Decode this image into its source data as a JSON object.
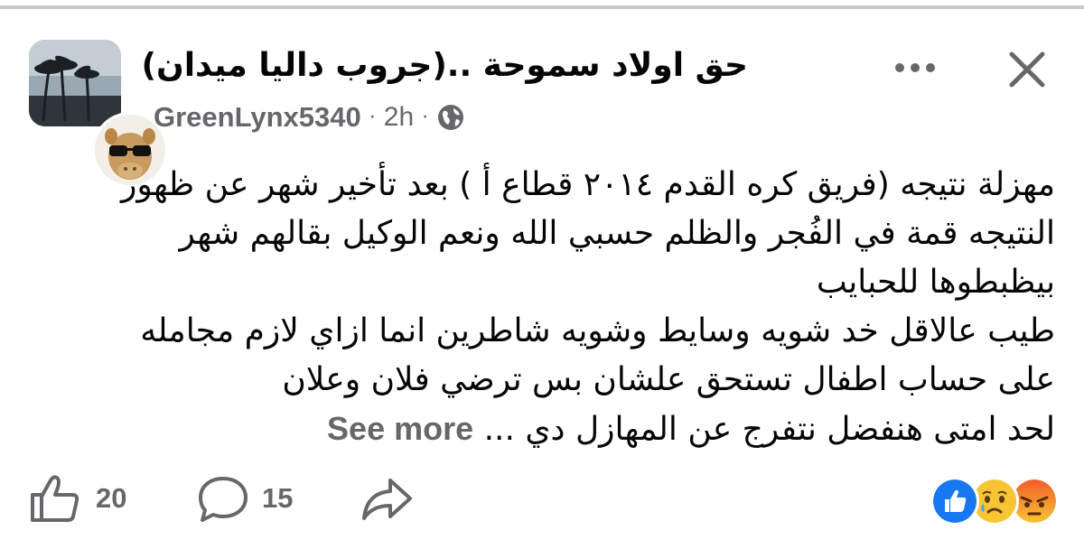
{
  "header": {
    "group_title": "حق اولاد سموحة ..(جروب داليا ميدان)",
    "author": "GreenLynx5340",
    "separator": "·",
    "time": "2h",
    "privacy_icon": "globe-icon",
    "more_icon": "more-dots-icon",
    "close_icon": "close-icon"
  },
  "post": {
    "lines": [
      "مهزلة نتيجه (فريق كره القدم ٢٠١٤ قطاع أ ) بعد تأخير شهر عن ظهور",
      "النتيجه قمة في الفُجر والظلم حسبي الله ونعم الوكيل بقالهم شهر",
      "بيظبطوها للحبايب",
      "طيب عالاقل خد شويه وسايط وشويه شاطرين انما ازاي لازم مجامله",
      "على حساب اطفال تستحق علشان بس ترضي فلان وعلان",
      "لحد امتى هنفضل نتفرج عن المهازل دي ..."
    ],
    "see_more": "See more"
  },
  "footer": {
    "like_count": "20",
    "comment_count": "15",
    "reactions": [
      "like-reaction-icon",
      "sad-reaction-icon",
      "angry-reaction-icon"
    ]
  },
  "colors": {
    "text_primary": "#050505",
    "text_secondary": "#65676b",
    "like_blue": "#1877f2",
    "reaction_yellow": "#f7c534",
    "angry_orange": "#f25c2a"
  }
}
